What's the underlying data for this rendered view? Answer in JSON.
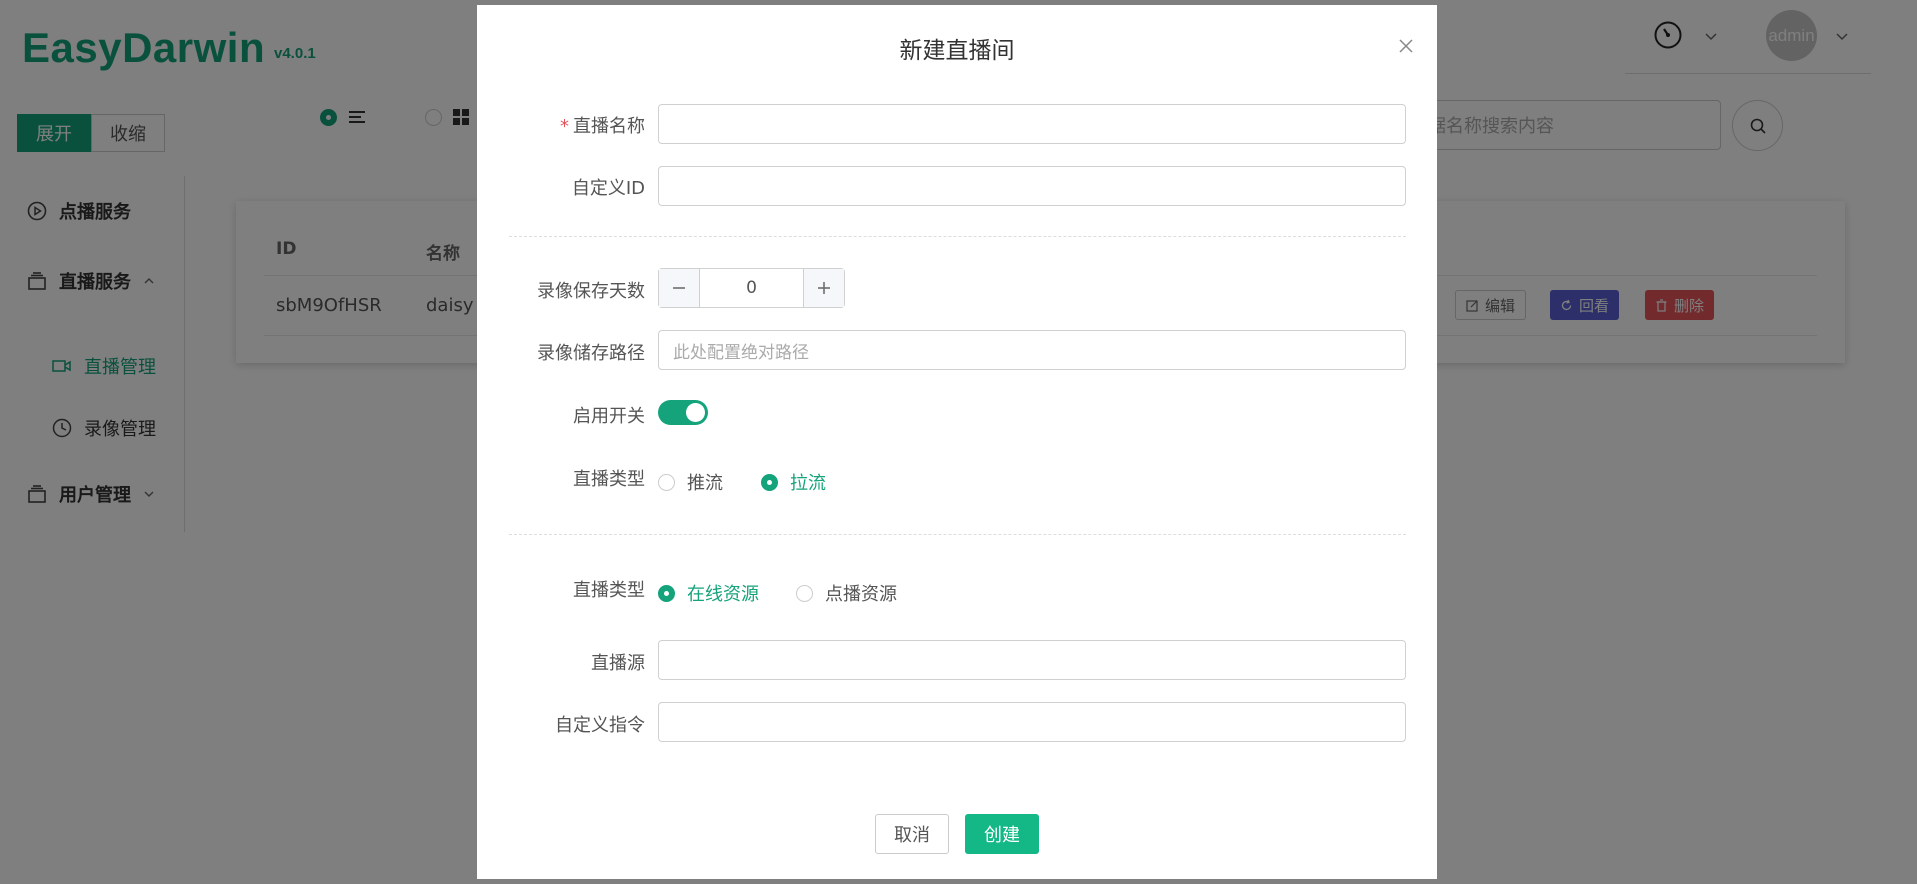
{
  "app": {
    "name": "EasyDarwin",
    "version": "v4.0.1"
  },
  "toggle": {
    "expand": "展开",
    "collapse": "收缩"
  },
  "sidebar": {
    "items": [
      {
        "label": "点播服务",
        "icon": "play-circle-icon"
      },
      {
        "label": "直播服务",
        "icon": "layers-icon"
      },
      {
        "label": "直播管理",
        "icon": "video-camera-icon"
      },
      {
        "label": "录像管理",
        "icon": "clock-icon"
      },
      {
        "label": "用户管理",
        "icon": "layers-icon"
      }
    ]
  },
  "search": {
    "placeholder": "根据名称搜索内容"
  },
  "user": {
    "name": "admin"
  },
  "table": {
    "columns": [
      "ID",
      "名称"
    ],
    "rows": [
      {
        "id": "sbM9OfHSR",
        "name": "daisy"
      }
    ],
    "actions": {
      "edit": "编辑",
      "replay": "回看",
      "delete": "删除"
    }
  },
  "modal": {
    "title": "新建直播间",
    "fields": {
      "name_label": "直播名称",
      "name_value": "",
      "custom_id_label": "自定义ID",
      "custom_id_value": "",
      "record_days_label": "录像保存天数",
      "record_days_value": "0",
      "record_path_label": "录像储存路径",
      "record_path_placeholder": "此处配置绝对路径",
      "enable_label": "启用开关",
      "enable_on": true,
      "live_type_label": "直播类型",
      "live_type_options": [
        "推流",
        "拉流"
      ],
      "live_type_selected": "拉流",
      "source_type_label": "直播类型",
      "source_type_options": [
        "在线资源",
        "点播资源"
      ],
      "source_type_selected": "在线资源",
      "source_label": "直播源",
      "source_value": "",
      "custom_cmd_label": "自定义指令",
      "custom_cmd_value": ""
    },
    "buttons": {
      "cancel": "取消",
      "create": "创建"
    }
  },
  "colors": {
    "brand": "#14a37a",
    "primary_button": "#14b886",
    "replay": "#5a5fd4",
    "danger": "#e5545a"
  }
}
